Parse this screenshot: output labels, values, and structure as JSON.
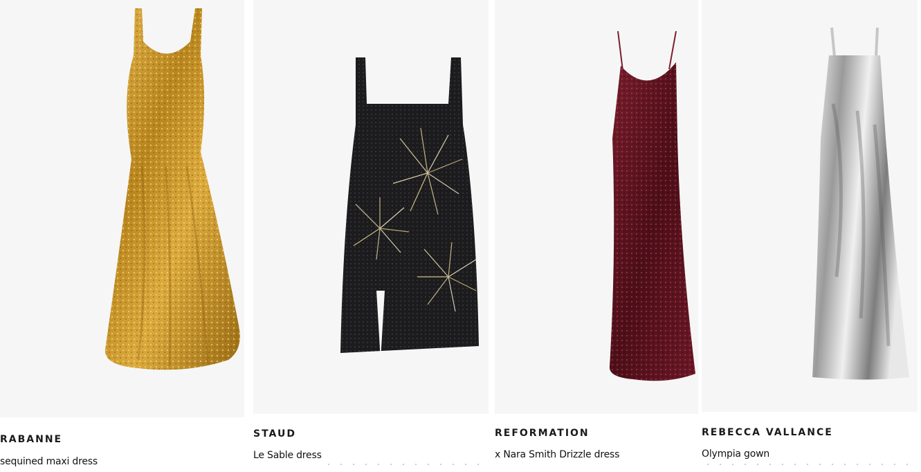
{
  "products": [
    {
      "brand": "RABANNE",
      "name": "sequined maxi dress",
      "image": {
        "icon": "gold-sequin-maxi-dress-image",
        "color": "#c9962a"
      }
    },
    {
      "brand": "STAUD",
      "name": "Le Sable dress",
      "image": {
        "icon": "black-embellished-mini-dress-image",
        "color": "#1c1c1e"
      }
    },
    {
      "brand": "REFORMATION",
      "name": "x Nara Smith Drizzle dress",
      "image": {
        "icon": "burgundy-sequin-slip-dress-image",
        "color": "#5c1620"
      }
    },
    {
      "brand": "REBECCA VALLANCE",
      "name": "Olympia gown",
      "image": {
        "icon": "silver-sequin-gown-image",
        "color": "#d9d9d9"
      }
    }
  ]
}
